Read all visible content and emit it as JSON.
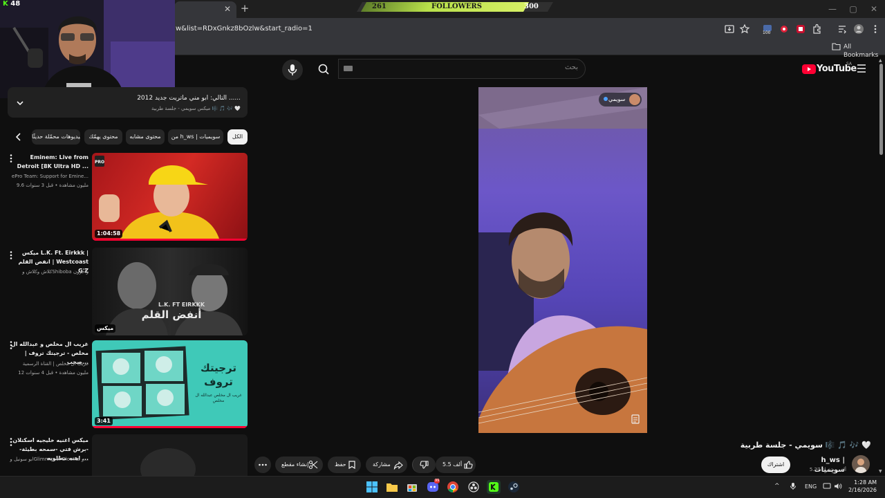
{
  "overlay": {
    "kick_viewers": "48",
    "followers_label": "FOLLOWERS",
    "followers_current": "261",
    "followers_goal": "300",
    "followers_progress": 0.87
  },
  "browser": {
    "url_fragment": "w&list=RDxGnkz8bOzlw&start_radio=1",
    "bookmarks_label": "All Bookmarks",
    "extension_badge": "100"
  },
  "masthead": {
    "search_placeholder": "بحث",
    "logo_text": "YouTube",
    "region_code": "SA"
  },
  "now_playing": {
    "title": "التالي: ابو مني ماتريت جديد 2012 ......",
    "subtitle": "ميكس سويمي - جلسة طربية 🎼 🎵 🎶 🤍"
  },
  "chips": [
    {
      "label": "الكل",
      "active": true
    },
    {
      "label": "من h_ws | سويميات",
      "active": false
    },
    {
      "label": "محتوى مشابه",
      "active": false
    },
    {
      "label": "محتوى يهمّك",
      "active": false
    },
    {
      "label": "فيديوهات محمّلة حديثًا",
      "active": false
    }
  ],
  "videos": [
    {
      "title": "Eminem: Live from Detroit [8K Ultra HD ...",
      "channel": "ePro Team: Support for Emine...",
      "meta": "9.6 مليون مشاهدة • قبل 3 سنوات",
      "duration": "1:04:58",
      "badge": "PRO"
    },
    {
      "title": "ميكس L.K. Ft. Eirkkk | انفض القلم | Westcoast G'Z",
      "channel": "كلاش وكلاش وShiboba وآخرون",
      "meta": "",
      "duration": "ميكس",
      "thumb_text": "L.K. FT EIRKKK",
      "thumb_arabic": "أنفض القلم"
    },
    {
      "title": "غريب ال مخلص و عبدالله ال مخلص - ترجيتك تروف | صخب...",
      "channel": "غريب ال مخلص | القناة الرسمية",
      "meta": "12 مليون مشاهدة • قبل 4 سنوات",
      "duration": "3:41",
      "thumb_text": "ترجيتك تروف",
      "thumb_sub": "غريب ال مخلص عبدالله ال مخلص"
    },
    {
      "title": "ميكس اغنيه خليجيه اسكتلان -برش فتي -سمحه بطيئة-اهنه مطلوبه ...",
      "channel": "ابو سونيل وGlimmer of Blooms و...",
      "meta": "",
      "duration": ""
    }
  ],
  "player": {
    "channel_pill": "سويمي"
  },
  "video_info": {
    "title": "سويمي - جلسة طربية 🎼 🎵 🎶 🤍",
    "channel": "h_ws | سويميات",
    "subscribers": "5.27 ألف مشترك",
    "subscribe_label": "اشتراك"
  },
  "actions": {
    "like_count": "5.5 ألف",
    "share_label": "مشاركة",
    "save_label": "حفظ",
    "clip_label": "إنشاء مقطع"
  },
  "taskbar": {
    "language": "ENG",
    "time": "1:28 AM",
    "date": "2/16/2026",
    "discord_badge": "99"
  },
  "colors": {
    "accent_red": "#ff0033",
    "background": "#0f0f0f",
    "chip_bg": "#272727",
    "follow_green": "#b8e04a",
    "kick_green": "#53fc18"
  }
}
